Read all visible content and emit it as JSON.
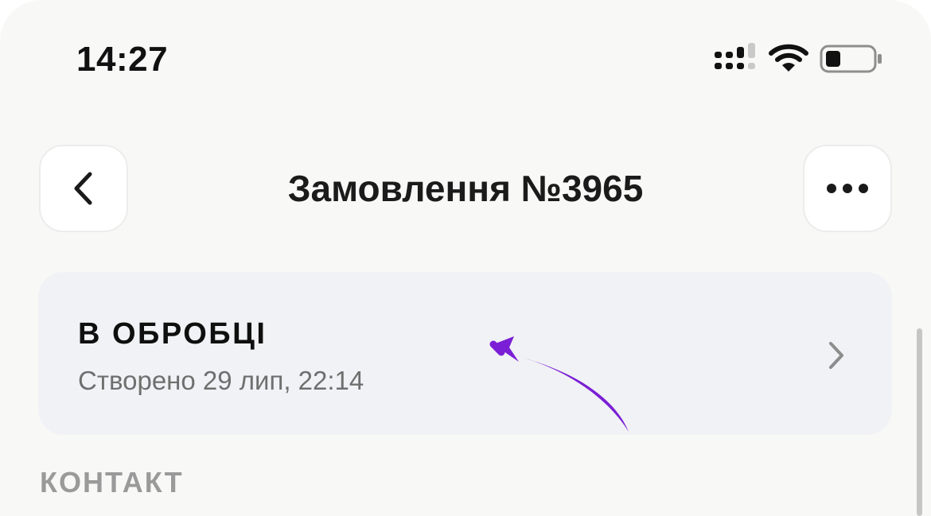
{
  "status_bar": {
    "time": "14:27",
    "icons": [
      "cellular-signal-icon",
      "wifi-icon",
      "battery-icon"
    ]
  },
  "header": {
    "title": "Замовлення №3965",
    "back_icon": "chevron-left-icon",
    "more_icon": "more-horizontal-icon"
  },
  "status_card": {
    "status": "В ОБРОБЦІ",
    "created": "Створено 29 лип, 22:14",
    "chevron_icon": "chevron-right-icon"
  },
  "sections": {
    "contact_label": "КОНТАКТ"
  },
  "colors": {
    "background": "#f8f8f7",
    "card": "#f1f2f5",
    "annotation_arrow": "#7b1fd6",
    "secondary_text": "#6f6f6f",
    "section_label": "#9a9a9a"
  }
}
